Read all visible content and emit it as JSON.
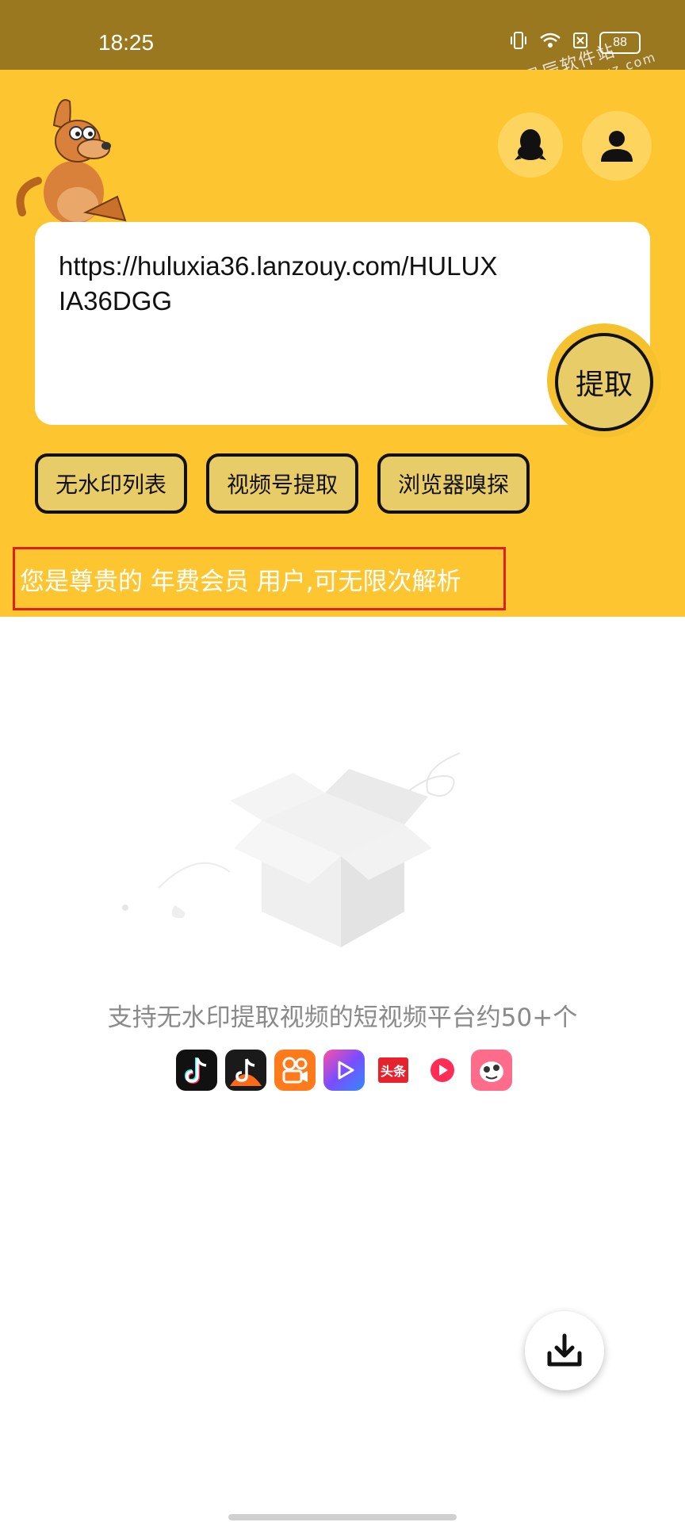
{
  "status_bar": {
    "time": "18:25",
    "battery": "88"
  },
  "watermark": {
    "name": "星辰软件站",
    "url": "www.121xz.com"
  },
  "input": {
    "url": "https://huluxia36.lanzouy.com/HULUXIA36DGG"
  },
  "extract_button": "提取",
  "actions": [
    {
      "label": "无水印列表"
    },
    {
      "label": "视频号提取"
    },
    {
      "label": "浏览器嗅探"
    }
  ],
  "vip_notice": "您是尊贵的 年费会员 用户,可无限次解析",
  "empty_state": {
    "support_text": "支持无水印提取视频的短视频平台约50+个"
  },
  "platforms": [
    {
      "icon": "douyin-icon",
      "color": "#111111"
    },
    {
      "icon": "douyin-huoshan-icon",
      "color": "#111111"
    },
    {
      "icon": "kuaishou-icon",
      "color": "#ff7a1a"
    },
    {
      "icon": "weishi-icon",
      "color": "#7b4dff"
    },
    {
      "icon": "toutiao-icon",
      "color": "#e8222c",
      "label": "头条"
    },
    {
      "icon": "xigua-icon",
      "color": "#ff2d55"
    },
    {
      "icon": "pipixia-icon",
      "color": "#ff6b8b"
    }
  ],
  "colors": {
    "primary": "#fdc631",
    "status_bar": "#9a7820",
    "button": "#e8cc68",
    "highlight_border": "#e02020"
  }
}
